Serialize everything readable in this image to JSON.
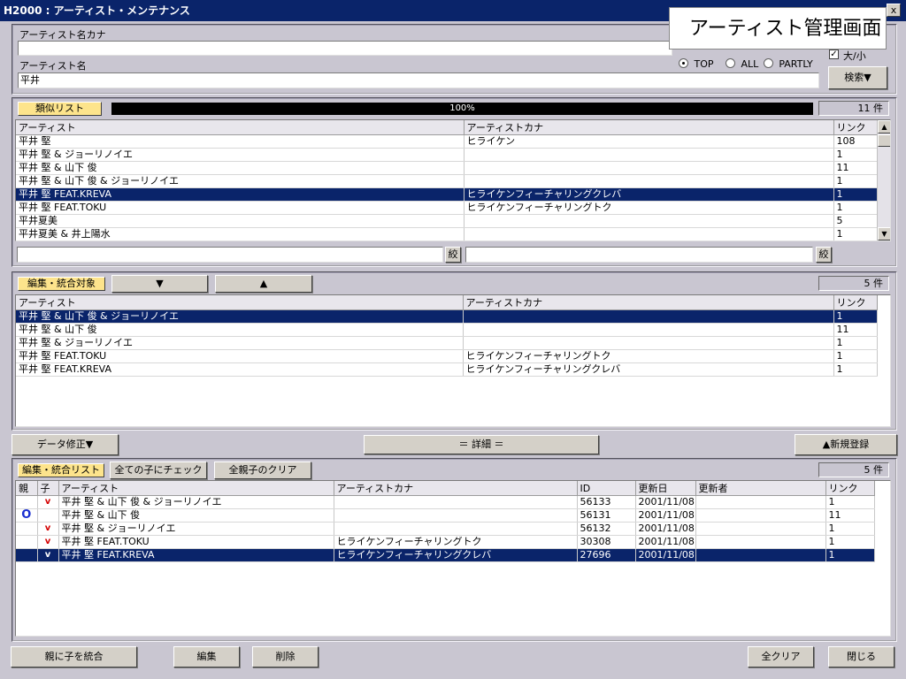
{
  "window": {
    "title": "H2000 : アーティスト・メンテナンス",
    "close_glyph": "x"
  },
  "caption": "アーティスト管理画面",
  "search": {
    "kana_label": "アーティスト名カナ",
    "kana_value": "",
    "name_label": "アーティスト名",
    "name_value": "平井",
    "checkbox_label": "大/小",
    "checkbox_checked": true,
    "radio_top": "TOP",
    "radio_all": "ALL",
    "radio_partly": "PARTLY",
    "radio_selected": "TOP",
    "search_button": "検索▼"
  },
  "similar": {
    "label": "類似リスト",
    "progress_text": "100%",
    "progress_value": 1.0,
    "count": "11 件",
    "columns": [
      "アーティスト",
      "アーティストカナ",
      "リンク"
    ],
    "rows": [
      {
        "artist": "平井 堅",
        "kana": "ヒライケン",
        "link": "108"
      },
      {
        "artist": "平井 堅 & ジョーリノイエ",
        "kana": "",
        "link": "1"
      },
      {
        "artist": "平井 堅 & 山下 俊",
        "kana": "",
        "link": "11"
      },
      {
        "artist": "平井 堅 & 山下 俊 & ジョーリノイエ",
        "kana": "",
        "link": "1"
      },
      {
        "artist": "平井 堅 FEAT.KREVA",
        "kana": "ヒライケンフィーチャリングクレバ",
        "link": "1",
        "selected": true
      },
      {
        "artist": "平井 堅 FEAT.TOKU",
        "kana": "ヒライケンフィーチャリングトク",
        "link": "1"
      },
      {
        "artist": "平井夏美",
        "kana": "",
        "link": "5"
      },
      {
        "artist": "平井夏美 & 井上陽水",
        "kana": "",
        "link": "1"
      }
    ],
    "filter1_value": "",
    "filter2_value": "",
    "filter_button": "絞"
  },
  "target": {
    "label": "編集・統合対象",
    "down_button": "▼",
    "up_button": "▲",
    "count": "5 件",
    "columns": [
      "アーティスト",
      "アーティストカナ",
      "リンク"
    ],
    "rows": [
      {
        "artist": "平井 堅 & 山下 俊 & ジョーリノイエ",
        "kana": "",
        "link": "1",
        "selected": true
      },
      {
        "artist": "平井 堅 & 山下 俊",
        "kana": "",
        "link": "11"
      },
      {
        "artist": "平井 堅 & ジョーリノイエ",
        "kana": "",
        "link": "1"
      },
      {
        "artist": "平井 堅 FEAT.TOKU",
        "kana": "ヒライケンフィーチャリングトク",
        "link": "1"
      },
      {
        "artist": "平井 堅 FEAT.KREVA",
        "kana": "ヒライケンフィーチャリングクレバ",
        "link": "1"
      }
    ]
  },
  "actions": {
    "data_fix": "データ修正▼",
    "detail": "＝ 詳細 ＝",
    "new_register": "▲新規登録"
  },
  "merge": {
    "label": "編集・統合リスト",
    "check_all_children": "全ての子にチェック",
    "clear_all": "全親子のクリア",
    "count": "5 件",
    "columns": [
      "親",
      "子",
      "アーティスト",
      "アーティストカナ",
      "ID",
      "更新日",
      "更新者",
      "リンク"
    ],
    "rows": [
      {
        "parent": "",
        "child": "v",
        "artist": "平井 堅 & 山下 俊 & ジョーリノイエ",
        "kana": "",
        "id": "56133",
        "date": "2001/11/08",
        "updater": "",
        "link": "1"
      },
      {
        "parent": "O",
        "child": "",
        "artist": "平井 堅 & 山下 俊",
        "kana": "",
        "id": "56131",
        "date": "2001/11/08",
        "updater": "",
        "link": "11"
      },
      {
        "parent": "",
        "child": "v",
        "artist": "平井 堅 & ジョーリノイエ",
        "kana": "",
        "id": "56132",
        "date": "2001/11/08",
        "updater": "",
        "link": "1"
      },
      {
        "parent": "",
        "child": "v",
        "artist": "平井 堅 FEAT.TOKU",
        "kana": "ヒライケンフィーチャリングトク",
        "id": "30308",
        "date": "2001/11/08",
        "updater": "",
        "link": "1"
      },
      {
        "parent": "",
        "child": "v",
        "artist": "平井 堅 FEAT.KREVA",
        "kana": "ヒライケンフィーチャリングクレバ",
        "id": "27696",
        "date": "2001/11/08",
        "updater": "",
        "link": "1",
        "selected": true
      }
    ]
  },
  "footer": {
    "merge_button": "親に子を統合",
    "edit_button": "編集",
    "delete_button": "削除",
    "clear_button": "全クリア",
    "close_button": "閉じる"
  },
  "colors": {
    "titlebar": "#0a246a",
    "selection": "#0a246a",
    "label_yellow": "#fde48c",
    "window_bg": "#c9c6d1"
  }
}
